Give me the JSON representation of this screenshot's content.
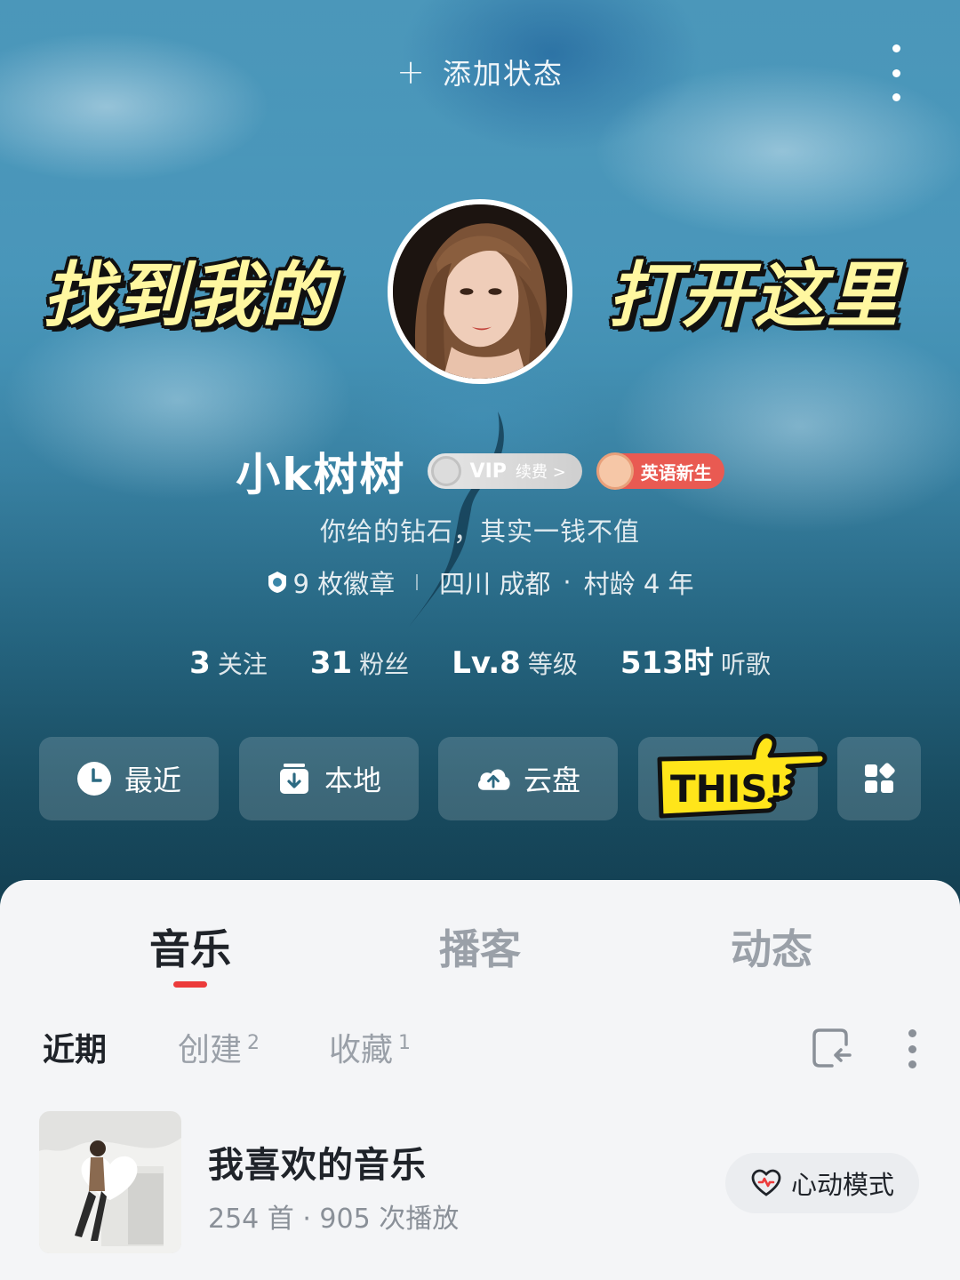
{
  "header": {
    "add_status_plus": "+",
    "add_status_label": "添加状态",
    "more_icon": "more-vertical-icon"
  },
  "overlay": {
    "banner_left": "找到我的",
    "banner_right": "打开这里",
    "this_label": "THIS!"
  },
  "profile": {
    "username": "小k树树",
    "vip_label": "VIP",
    "vip_renew": "续费 >",
    "tag_label": "英语新生",
    "signature": "你给的钻石，其实一钱不值",
    "badges": "9 枚徽章",
    "location": "四川 成都",
    "dot": "·",
    "village_age": "村龄 4 年"
  },
  "stats": [
    {
      "num": "3",
      "label": "关注"
    },
    {
      "num": "31",
      "label": "粉丝"
    },
    {
      "num": "Lv.8",
      "label": "等级"
    },
    {
      "num": "513时",
      "label": "听歌"
    }
  ],
  "quick_actions": [
    {
      "label": "最近",
      "icon": "clock-icon"
    },
    {
      "label": "本地",
      "icon": "download-box-icon"
    },
    {
      "label": "云盘",
      "icon": "cloud-upload-icon"
    },
    {
      "label": "",
      "icon": "grid-icon"
    }
  ],
  "tabs": [
    "音乐",
    "播客",
    "动态"
  ],
  "active_tab": "音乐",
  "subtabs": [
    {
      "label": "近期",
      "count": ""
    },
    {
      "label": "创建",
      "count": "2"
    },
    {
      "label": "收藏",
      "count": "1"
    }
  ],
  "playlist": {
    "title": "我喜欢的音乐",
    "subtitle": "254 首 · 905 次播放",
    "heart_mode_label": "心动模式"
  },
  "colors": {
    "accent_red": "#ec3b3b",
    "vip_tag_red": "#e95a52",
    "highlight_yellow": "#fff7a0"
  }
}
